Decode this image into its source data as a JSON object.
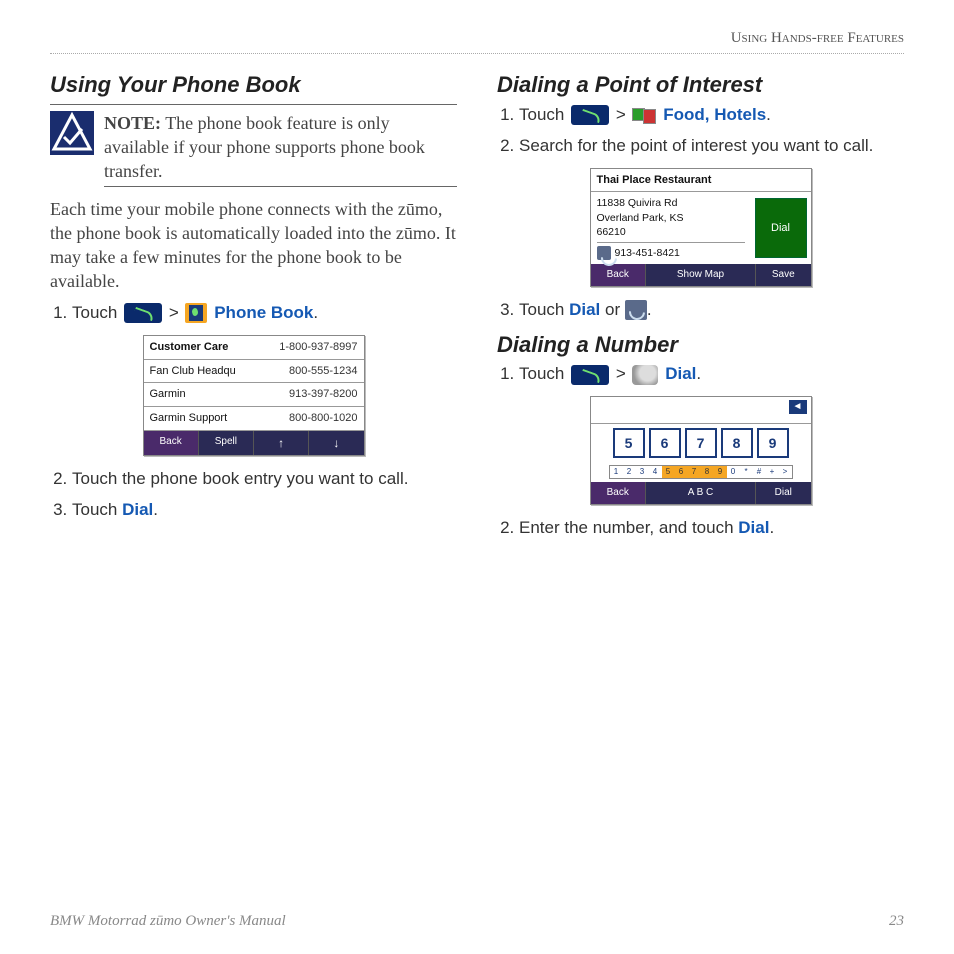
{
  "header": "Using Hands-free Features",
  "left": {
    "title": "Using Your Phone Book",
    "note_label": "NOTE:",
    "note_text": " The phone book feature is only available if your phone supports phone book transfer.",
    "body": "Each time your mobile phone connects with the zūmo, the phone book is automatically loaded into the zūmo. It may take a few minutes for the phone book to be available.",
    "step1_pre": "Touch ",
    "step1_sep": " > ",
    "step1_link": " Phone Book",
    "step1_post": ".",
    "shot": {
      "rows": [
        {
          "name": "Customer Care",
          "num": "1-800-937-8997"
        },
        {
          "name": "Fan Club Headqu",
          "num": "800-555-1234"
        },
        {
          "name": "Garmin",
          "num": "913-397-8200"
        },
        {
          "name": "Garmin Support",
          "num": "800-800-1020"
        }
      ],
      "btns": {
        "back": "Back",
        "spell": "Spell",
        "up": "↑",
        "down": "↓"
      }
    },
    "step2": "Touch the phone book entry you want to call.",
    "step3_pre": "Touch ",
    "step3_link": "Dial",
    "step3_post": "."
  },
  "right": {
    "sec1": {
      "title": "Dialing a Point of Interest",
      "step1_pre": "Touch ",
      "step1_sep": " > ",
      "step1_link": " Food, Hotels",
      "step1_post": ".",
      "step2": "Search for the point of interest you want to call.",
      "shot": {
        "title": "Thai Place Restaurant",
        "addr1": "11838 Quivira Rd",
        "addr2": "Overland Park, KS",
        "addr3": "66210",
        "phone": "913-451-8421",
        "dial": "Dial",
        "btns": {
          "back": "Back",
          "showmap": "Show Map",
          "save": "Save"
        }
      },
      "step3_pre": "Touch ",
      "step3_link": "Dial",
      "step3_mid": " or ",
      "step3_post": "."
    },
    "sec2": {
      "title": "Dialing a Number",
      "step1_pre": "Touch ",
      "step1_sep": " > ",
      "step1_link": " Dial",
      "step1_post": ".",
      "shot": {
        "keys": [
          "5",
          "6",
          "7",
          "8",
          "9"
        ],
        "strip_left": [
          "1",
          "2",
          "3",
          "4"
        ],
        "strip_mid": [
          "5",
          "6",
          "7",
          "8",
          "9"
        ],
        "strip_right": [
          "0",
          "*",
          "#",
          "+",
          ">"
        ],
        "bksp": "◄",
        "btns": {
          "back": "Back",
          "abc": "A B C",
          "dial": "Dial"
        }
      },
      "step2_pre": "Enter the number, and touch ",
      "step2_link": "Dial",
      "step2_post": "."
    }
  },
  "footer": {
    "left": "BMW Motorrad zūmo Owner's Manual",
    "right": "23"
  }
}
